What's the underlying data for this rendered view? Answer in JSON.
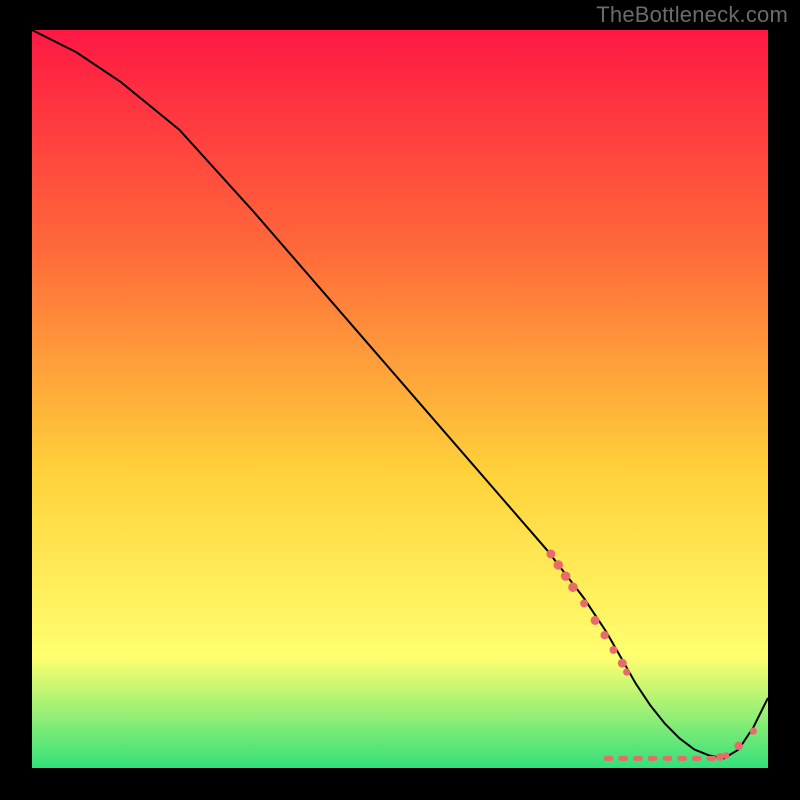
{
  "watermark": "TheBottleneck.com",
  "colors": {
    "background": "#000000",
    "gradient_top": "#ff1844",
    "gradient_mid1": "#ff6a3a",
    "gradient_mid2": "#ffd23a",
    "gradient_mid3": "#ffff70",
    "gradient_bottom": "#33e07a",
    "curve": "#000000",
    "markers": "#e86a6a",
    "watermark_text": "#6b6b6b"
  },
  "chart_data": {
    "type": "line",
    "title": "",
    "xlabel": "",
    "ylabel": "",
    "xlim": [
      0,
      100
    ],
    "ylim": [
      0,
      100
    ],
    "curve": {
      "x": [
        0,
        6,
        12,
        20,
        30,
        40,
        50,
        60,
        70,
        75,
        78,
        80,
        82,
        84,
        86,
        88,
        90,
        92,
        94,
        96,
        98,
        100
      ],
      "y": [
        100,
        97,
        93,
        86.5,
        75.5,
        64,
        52.5,
        41,
        29.5,
        23,
        18.5,
        15,
        11.5,
        8.5,
        6,
        4,
        2.5,
        1.7,
        1.3,
        2.5,
        5.5,
        9.5
      ]
    },
    "markers": [
      {
        "x": 70.5,
        "y": 29,
        "r": 3.2
      },
      {
        "x": 71.5,
        "y": 27.5,
        "r": 3.4
      },
      {
        "x": 72.5,
        "y": 26,
        "r": 3.4
      },
      {
        "x": 73.5,
        "y": 24.5,
        "r": 3.4
      },
      {
        "x": 75.0,
        "y": 22.3,
        "r": 2.8
      },
      {
        "x": 76.5,
        "y": 20.0,
        "r": 3.2
      },
      {
        "x": 77.8,
        "y": 18.0,
        "r": 3.0
      },
      {
        "x": 79.0,
        "y": 16.0,
        "r": 2.8
      },
      {
        "x": 80.2,
        "y": 14.2,
        "r": 3.2
      },
      {
        "x": 80.8,
        "y": 13.0,
        "r": 2.6
      },
      {
        "x": 93.5,
        "y": 1.5,
        "r": 2.8
      },
      {
        "x": 94.3,
        "y": 1.7,
        "r": 2.4
      },
      {
        "x": 96.0,
        "y": 3.0,
        "r": 3.0
      },
      {
        "x": 98.0,
        "y": 5.0,
        "r": 2.6
      }
    ],
    "dash_y": 1.3,
    "dash_x_start": 78,
    "dash_x_end": 94,
    "dash_segments": 16
  }
}
